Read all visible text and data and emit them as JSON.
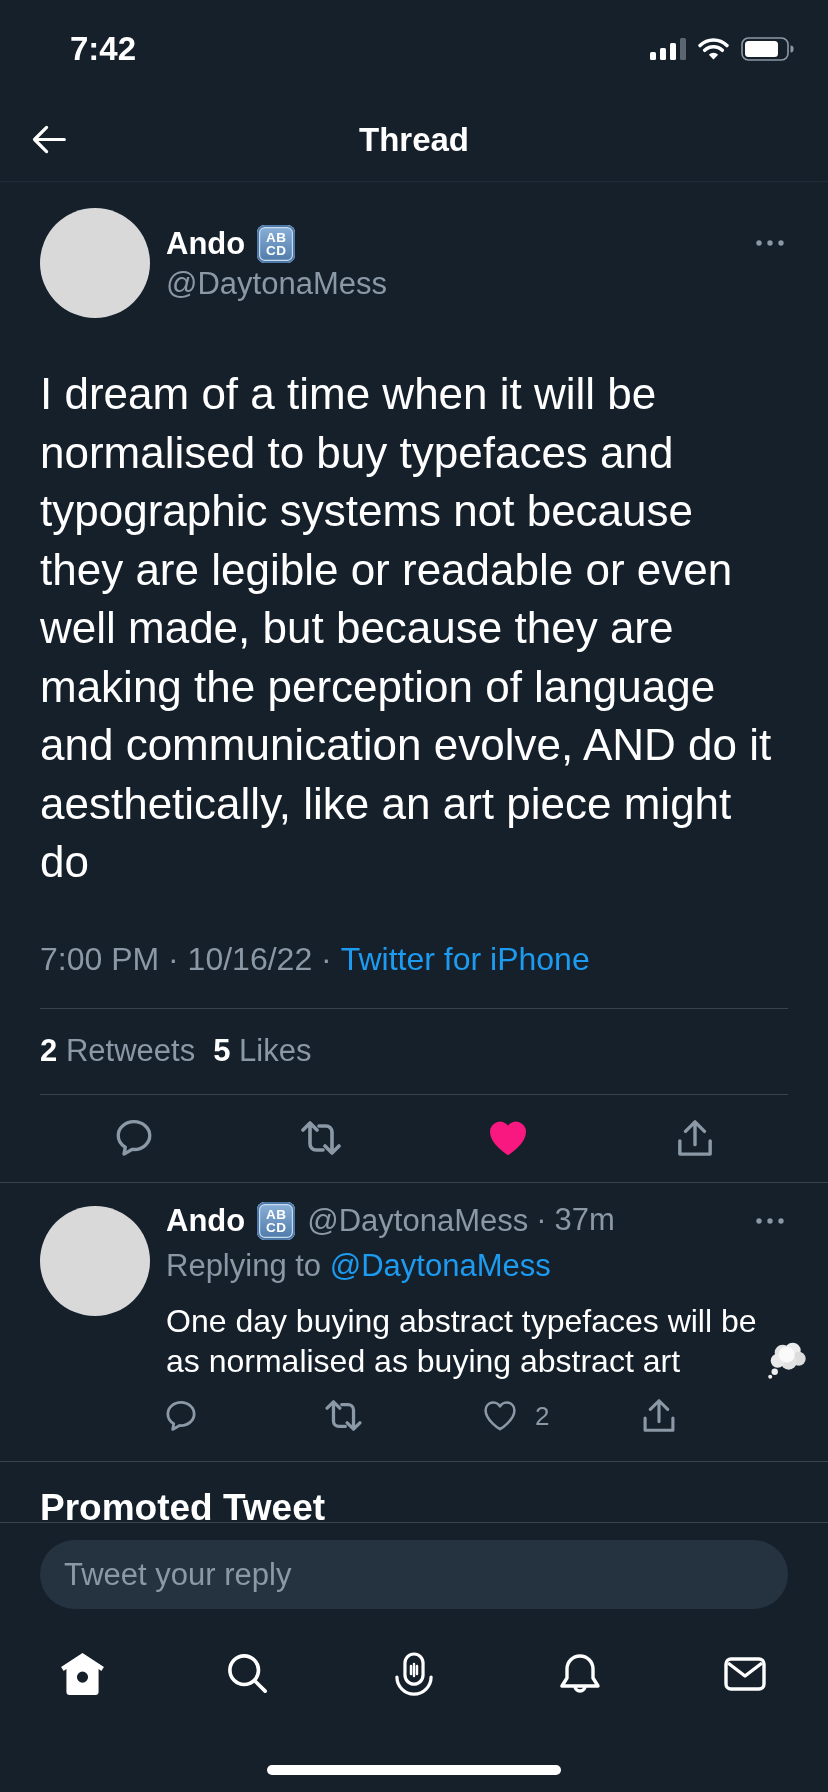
{
  "status_bar": {
    "time": "7:42"
  },
  "header": {
    "title": "Thread"
  },
  "tweet": {
    "author": {
      "name": "Ando",
      "emoji_lines": [
        "AB",
        "CD"
      ],
      "handle": "@DaytonaMess"
    },
    "text": "I dream of a time when it will be normalised to buy typefaces and typographic systems not because they are legible or readable or even well made, but because they are making the perception of language and communication evolve, AND do it aesthetically, like an art piece might do",
    "timestamp": "7:00 PM · 10/16/22 ·",
    "source": "Twitter for iPhone",
    "stats": [
      {
        "count": "2",
        "label": "Retweets"
      },
      {
        "count": "5",
        "label": "Likes"
      }
    ],
    "liked": true
  },
  "replies": [
    {
      "name": "Ando",
      "emoji_lines": [
        "AB",
        "CD"
      ],
      "handle": "@DaytonaMess",
      "separator": "·",
      "age": "37m",
      "replying_label": "Replying to",
      "replying_to": "@DaytonaMess",
      "text": "One day buying abstract typefaces will be as normalised as buying abstract art",
      "like_count": "2",
      "liked": false
    }
  ],
  "promoted": {
    "title": "Promoted Tweet"
  },
  "compose": {
    "placeholder": "Tweet your reply"
  },
  "tab_bar": [
    {
      "kind": "home",
      "selected": true
    },
    {
      "kind": "search",
      "selected": false
    },
    {
      "kind": "spaces",
      "selected": false
    },
    {
      "kind": "notifications",
      "selected": false
    },
    {
      "kind": "messages",
      "selected": false
    }
  ]
}
